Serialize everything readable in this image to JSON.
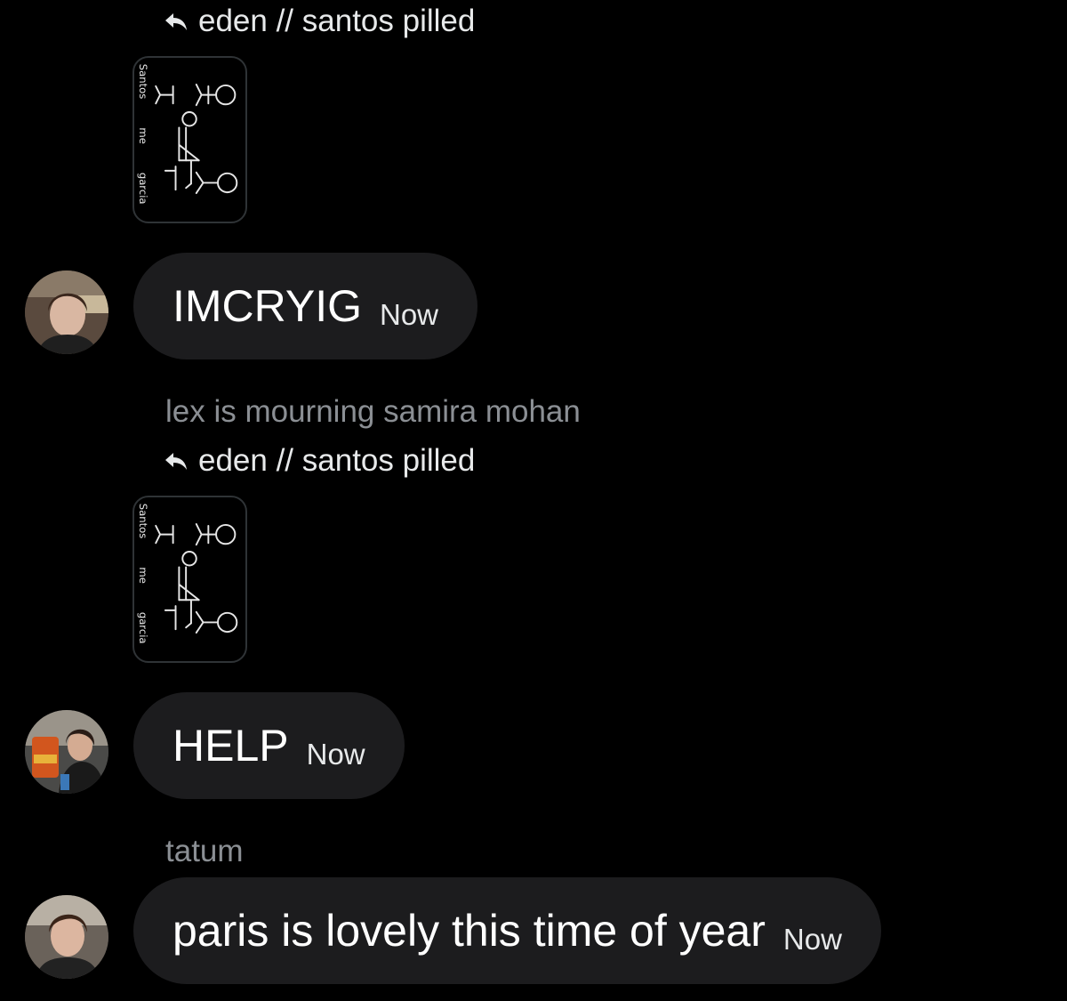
{
  "messages": [
    {
      "reply_to": "eden // santos pilled",
      "sticker_text": [
        "Santos",
        "me",
        "garcia"
      ],
      "text": "IMCRYIG",
      "time": "Now"
    },
    {
      "sender": "lex is mourning samira mohan",
      "reply_to": "eden // santos pilled",
      "sticker_text": [
        "Santos",
        "me",
        "garcia"
      ],
      "text": "HELP",
      "time": "Now"
    },
    {
      "sender": "tatum",
      "text": "paris is lovely this time of year",
      "time": "Now"
    }
  ],
  "icons": {
    "reply": "reply-arrow-icon"
  },
  "colors": {
    "background": "#000000",
    "bubble": "#1c1c1e",
    "muted_text": "#8b8f94",
    "text": "#ffffff"
  }
}
